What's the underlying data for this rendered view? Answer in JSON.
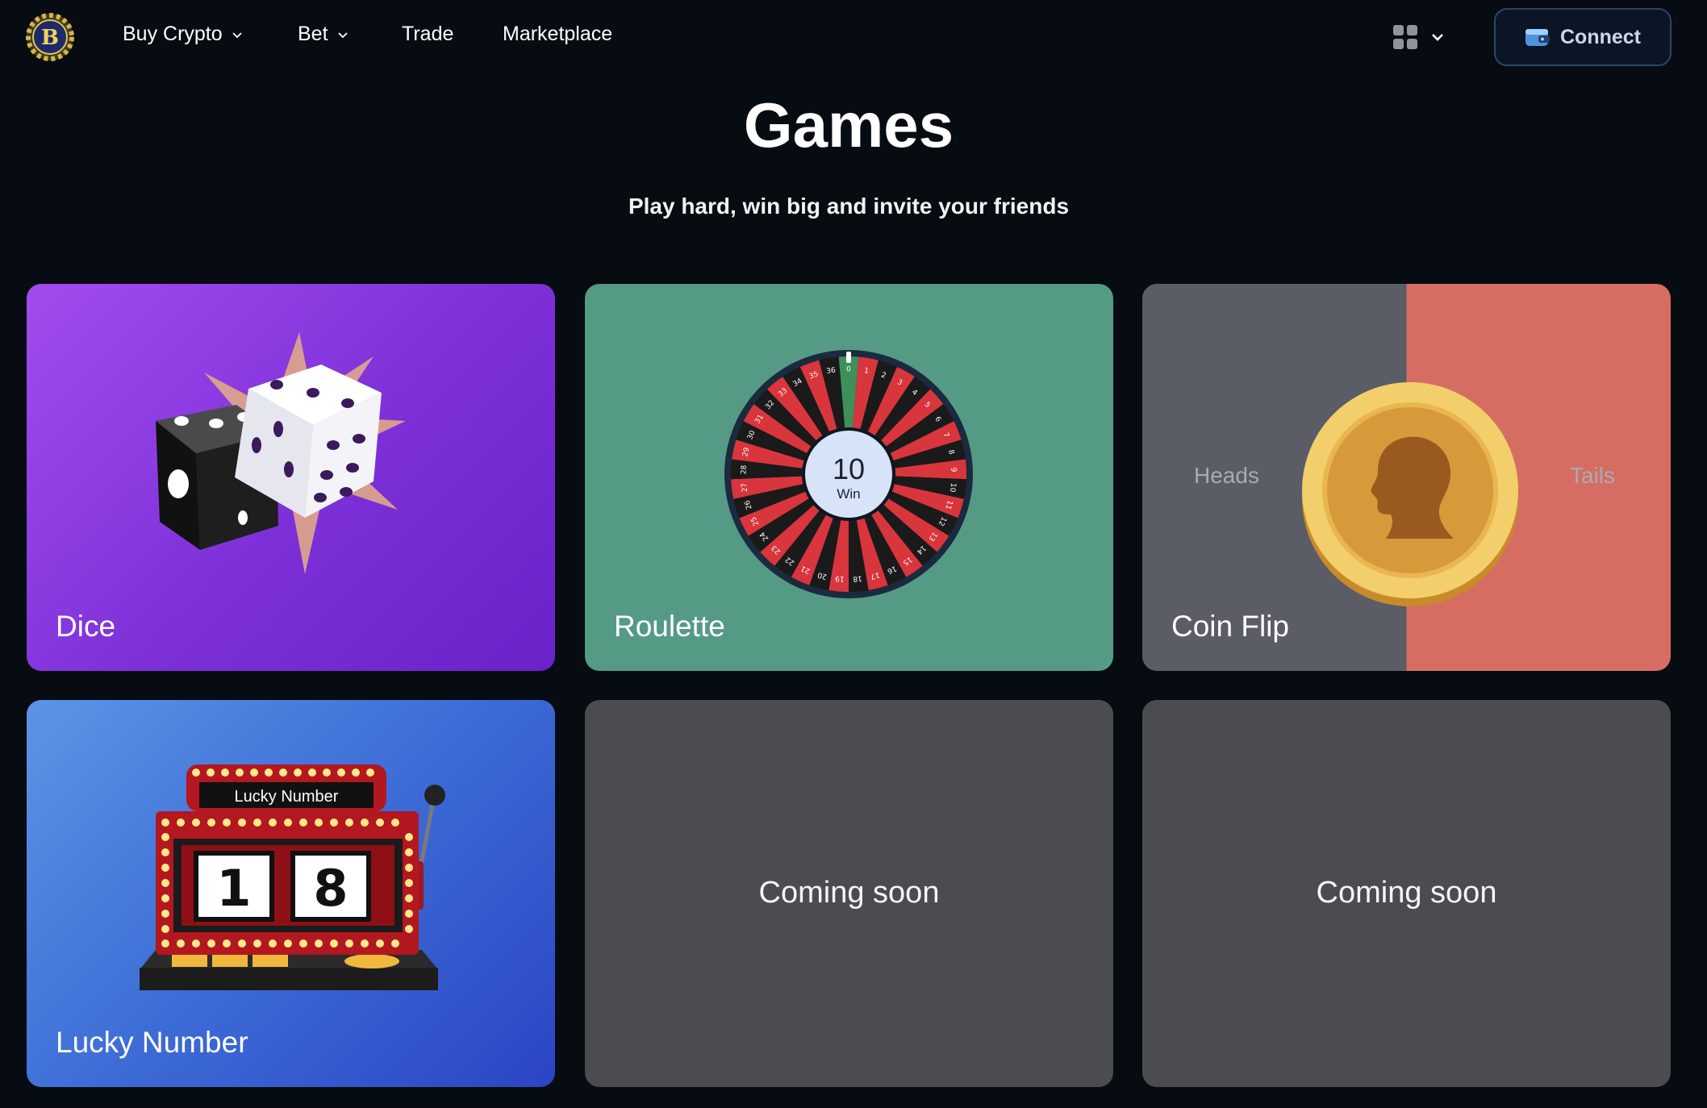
{
  "nav": {
    "logo_letter": "B",
    "links": [
      {
        "label": "Buy Crypto",
        "has_dropdown": true
      },
      {
        "label": "Bet",
        "has_dropdown": true
      },
      {
        "label": "Trade",
        "has_dropdown": false
      },
      {
        "label": "Marketplace",
        "has_dropdown": false
      }
    ],
    "apps_icon": "grid-icon",
    "connect_label": "Connect",
    "connect_icon": "wallet-icon"
  },
  "header": {
    "title": "Games",
    "subtitle": "Play hard, win big and invite your friends"
  },
  "games": [
    {
      "label": "Dice",
      "icon": "dice-icon",
      "color": "#8a3ae0"
    },
    {
      "label": "Roulette",
      "icon": "roulette-wheel-icon",
      "color": "#559a84",
      "wheel": {
        "result": "10",
        "result_label": "Win",
        "numbers": [
          "0",
          "1",
          "2",
          "3",
          "4",
          "5",
          "6",
          "7",
          "8",
          "9",
          "10",
          "11",
          "12",
          "13",
          "14",
          "15",
          "16",
          "17",
          "18",
          "19",
          "20",
          "21",
          "22",
          "23",
          "24",
          "25",
          "26",
          "27",
          "28",
          "29",
          "30",
          "31",
          "32",
          "33",
          "34",
          "35",
          "36"
        ]
      }
    },
    {
      "label": "Coin Flip",
      "icon": "coin-icon",
      "heads_label": "Heads",
      "tails_label": "Tails"
    },
    {
      "label": "Lucky Number",
      "icon": "slot-machine-icon",
      "sign": "Lucky Number",
      "digits": [
        "1",
        "8"
      ]
    }
  ],
  "coming_soon": [
    "Coming soon",
    "Coming soon"
  ],
  "colors": {
    "background": "#070b12",
    "coming_soon_card": "#4b4c50",
    "coin_heads_side": "#5a5c66",
    "coin_tails_side": "#d66d63",
    "connect_border": "#2b4766"
  }
}
